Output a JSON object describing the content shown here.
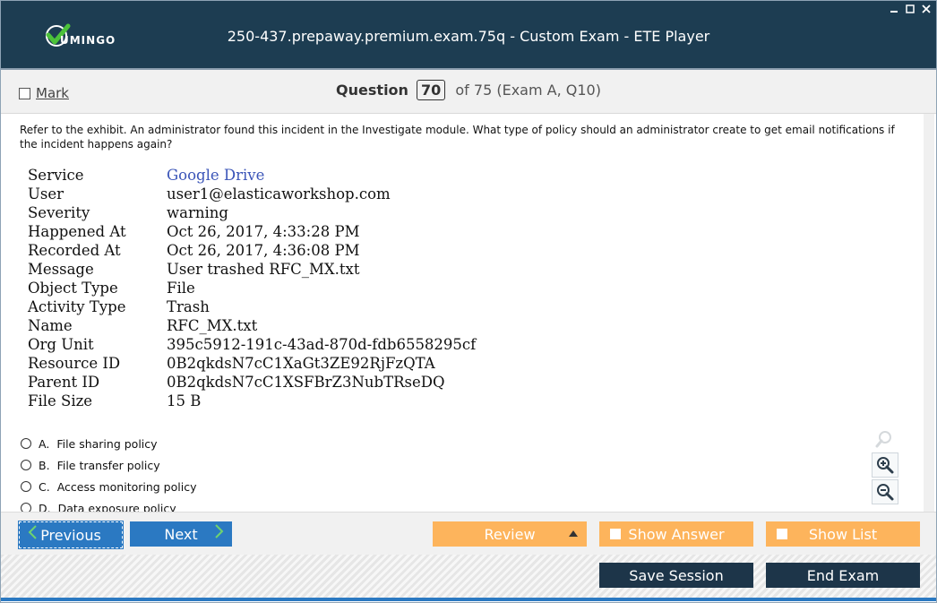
{
  "window": {
    "title": "250-437.prepaway.premium.exam.75q - Custom Exam - ETE Player",
    "logo_text": "UMINGO",
    "controls": [
      "minimize",
      "maximize",
      "close"
    ]
  },
  "header": {
    "mark_label": "Mark",
    "question_label": "Question",
    "question_number": "70",
    "question_suffix": "of 75 (Exam A, Q10)"
  },
  "question": {
    "text": "Refer to the exhibit. An administrator found this incident in the Investigate module. What type of policy should an administrator create to get email notifications if the incident happens again?"
  },
  "exhibit": {
    "rows": [
      {
        "key": "Service",
        "value": "Google Drive"
      },
      {
        "key": "User",
        "value": "user1@elasticaworkshop.com"
      },
      {
        "key": "Severity",
        "value": "warning"
      },
      {
        "key": "Happened At",
        "value": "Oct 26, 2017, 4:33:28 PM"
      },
      {
        "key": "Recorded At",
        "value": "Oct 26, 2017, 4:36:08 PM"
      },
      {
        "key": "Message",
        "value": "User trashed RFC_MX.txt"
      },
      {
        "key": "Object Type",
        "value": "File"
      },
      {
        "key": "Activity Type",
        "value": "Trash"
      },
      {
        "key": "Name",
        "value": "RFC_MX.txt"
      },
      {
        "key": "Org Unit",
        "value": "395c5912-191c-43ad-870d-fdb6558295cf"
      },
      {
        "key": "Resource ID",
        "value": "0B2qkdsN7cC1XaGt3ZE92RjFzQTA"
      },
      {
        "key": "Parent ID",
        "value": "0B2qkdsN7cC1XSFBrZ3NubTRseDQ"
      },
      {
        "key": "File Size",
        "value": "15 B"
      }
    ]
  },
  "options": [
    {
      "letter": "A.",
      "text": "File sharing policy"
    },
    {
      "letter": "B.",
      "text": "File transfer policy"
    },
    {
      "letter": "C.",
      "text": "Access monitoring policy"
    },
    {
      "letter": "D.",
      "text": "Data exposure policy"
    }
  ],
  "toolbar": {
    "previous_label": "Previous",
    "next_label": "Next",
    "review_label": "Review",
    "show_answer_label": "Show Answer",
    "show_list_label": "Show List",
    "save_session_label": "Save Session",
    "end_exam_label": "End Exam"
  },
  "colors": {
    "titlebar": "#1d3d52",
    "primary_button": "#2b79c2",
    "secondary_button": "#fdb45c",
    "dark_button": "#1d3549",
    "link": "#3b55b8"
  }
}
